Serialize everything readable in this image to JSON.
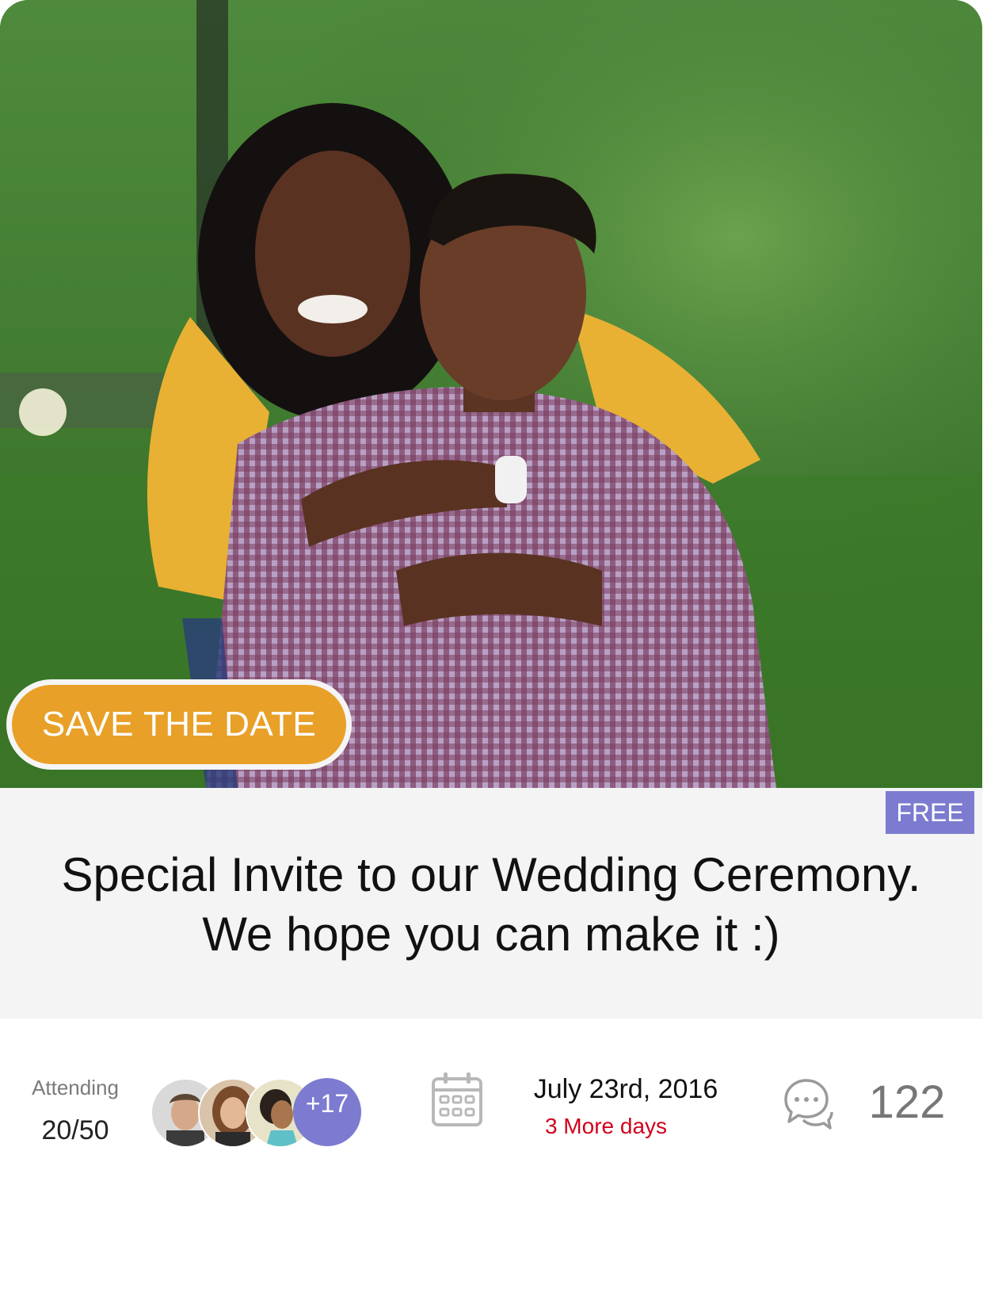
{
  "hero": {
    "save_label": "SAVE THE DATE"
  },
  "event": {
    "price_badge": "FREE",
    "title": "Special Invite to our Wedding Ceremony. We hope you can make it :)"
  },
  "attendance": {
    "label": "Attending",
    "count": "20/50",
    "more_label": "+17"
  },
  "schedule": {
    "date": "July 23rd, 2016",
    "countdown": "3 More days"
  },
  "comments": {
    "count": "122"
  },
  "colors": {
    "accent_orange": "#e8a028",
    "accent_purple": "#7c7bd0",
    "countdown_red": "#d0021b",
    "panel_gray": "#f3f4f3"
  },
  "icons": {
    "calendar": "calendar-icon",
    "comments": "chat-bubbles-icon"
  }
}
